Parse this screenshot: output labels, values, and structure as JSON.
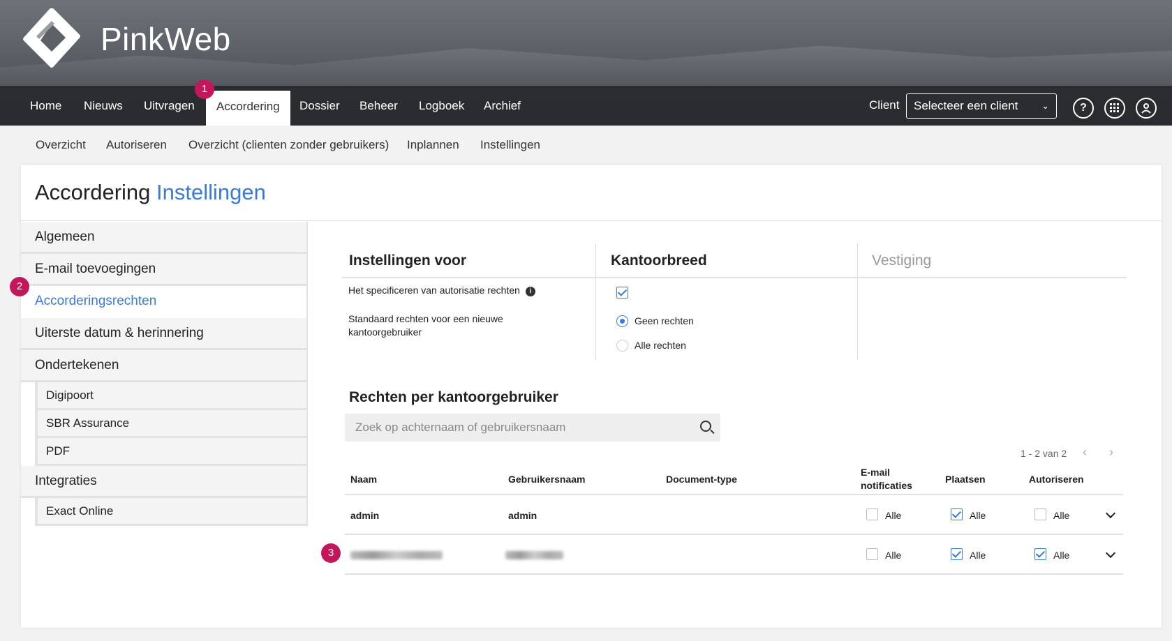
{
  "app": {
    "name": "PinkWeb"
  },
  "nav": {
    "items": [
      "Home",
      "Nieuws",
      "Uitvragen",
      "Accordering",
      "Dossier",
      "Beheer",
      "Logboek",
      "Archief"
    ],
    "active": "Accordering",
    "client_label": "Client",
    "client_select": "Selecteer een client"
  },
  "badges": {
    "b1": "1",
    "b2": "2",
    "b3": "3"
  },
  "subnav": [
    "Overzicht",
    "Autoriseren",
    "Overzicht (clienten zonder gebruikers)",
    "Inplannen",
    "Instellingen"
  ],
  "page": {
    "title_main": "Accordering",
    "title_accent": "Instellingen"
  },
  "side": {
    "items": [
      "Algemeen",
      "E-mail toevoegingen",
      "Accorderingsrechten",
      "Uiterste datum & herinnering",
      "Ondertekenen",
      "Integraties"
    ],
    "ondertekenen_sub": [
      "Digipoort",
      "SBR Assurance",
      "PDF"
    ],
    "integraties_sub": [
      "Exact Online"
    ],
    "selected": "Accorderingsrechten"
  },
  "settings": {
    "col1": "Instellingen voor",
    "col2": "Kantoorbreed",
    "col3": "Vestiging",
    "row1_label": "Het specificeren van autorisatie rechten",
    "row1_checked": true,
    "row2_label": "Standaard rechten voor een nieuwe kantoorgebruiker",
    "radio_options": [
      "Geen rechten",
      "Alle rechten"
    ],
    "radio_selected": "Geen rechten"
  },
  "users": {
    "title": "Rechten per kantoorgebruiker",
    "search_placeholder": "Zoek op achternaam of gebruikersnaam",
    "pager": "1 - 2 van 2",
    "headers": [
      "Naam",
      "Gebruikersnaam",
      "Document-type",
      "E-mail notificaties",
      "Plaatsen",
      "Autoriseren"
    ],
    "check_label": "Alle",
    "rows": [
      {
        "naam": "admin",
        "gebruikersnaam": "admin",
        "email": false,
        "plaatsen": true,
        "autoriseren": false
      },
      {
        "naam": "",
        "gebruikersnaam": "",
        "email": false,
        "plaatsen": true,
        "autoriseren": true
      }
    ]
  },
  "colors": {
    "accent": "#3a7bd5",
    "badge": "#c2185b",
    "nav_bg": "#2a2c30"
  }
}
